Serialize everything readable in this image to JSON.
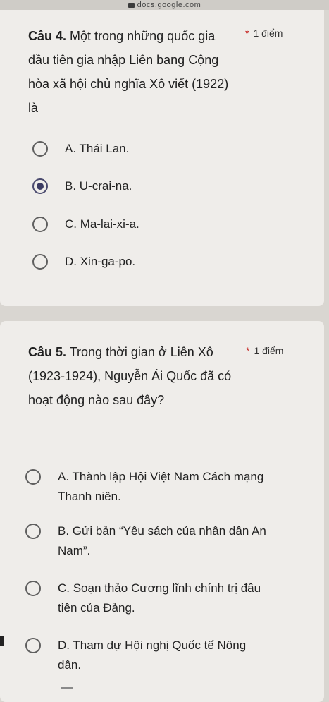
{
  "browser": {
    "url": "docs.google.com"
  },
  "question4": {
    "number": "Câu 4.",
    "text": "Một trong những quốc gia đầu tiên gia nhập Liên bang Cộng hòa xã hội chủ nghĩa Xô viết (1922) là",
    "points": "1 điểm",
    "options": [
      {
        "label": "A. Thái Lan.",
        "selected": false
      },
      {
        "label": "B. U-crai-na.",
        "selected": true
      },
      {
        "label": "C. Ma-lai-xi-a.",
        "selected": false
      },
      {
        "label": "D. Xin-ga-po.",
        "selected": false
      }
    ]
  },
  "question5": {
    "number": "Câu 5.",
    "text": "Trong thời gian ở Liên Xô (1923-1924), Nguyễn Ái Quốc đã có hoạt động nào sau đây?",
    "points": "1 điểm",
    "options": [
      {
        "label": "A. Thành lập Hội Việt Nam Cách mạng Thanh niên.",
        "selected": false
      },
      {
        "label": "B. Gửi bản “Yêu sách của nhân dân An Nam”.",
        "selected": false
      },
      {
        "label": "C. Soạn thảo Cương lĩnh chính trị đầu tiên của Đảng.",
        "selected": false
      },
      {
        "label": "D. Tham dự Hội nghị Quốc tế Nông dân.",
        "selected": false
      }
    ]
  },
  "colors": {
    "required_star": "#c5221f",
    "card_bg": "#efedea",
    "page_bg": "#d9d6d1"
  }
}
